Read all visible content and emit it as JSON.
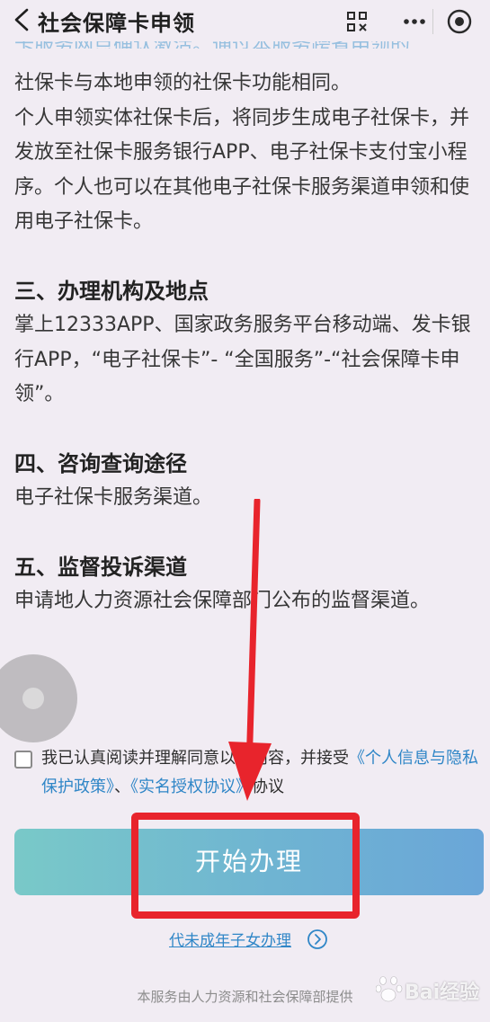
{
  "nav": {
    "title": "社会保障卡申领",
    "back_icon": "chevron-left-icon",
    "capsule_icons": [
      "scan-icon",
      "more-icon",
      "close-circle-icon"
    ]
  },
  "content": {
    "partial_top_line": "卡服务网点确认激活。通过本服务跨省申领的",
    "paragraph_1_line_1": "社保卡与本地申领的社保卡功能相同。",
    "paragraph_2": "个人申领实体社保卡后，将同步生成电子社保卡，并发放至社保卡服务银行APP、电子社保卡支付宝小程序。个人也可以在其他电子社保卡服务渠道申领和使用电子社保卡。",
    "section_3_title": "三、办理机构及地点",
    "section_3_body": "掌上12333APP、国家政务服务平台移动端、发卡银行APP，“电子社保卡”- “全国服务”-“社会保障卡申领”。",
    "section_4_title": "四、咨询查询途径",
    "section_4_body": "电子社保卡服务渠道。",
    "section_5_title": "五、监督投诉渠道",
    "section_5_body": "申请地人力资源社会保障部门公布的监督渠道。"
  },
  "agreement": {
    "text_before": "我已认真阅读并理解同意以上内容，并接受",
    "link_privacy": "《个人信息与隐私保护政策》",
    "separator": "、",
    "link_realname": "《实名授权协议》",
    "text_after": "协议",
    "checked": false
  },
  "start_button": {
    "label": "开始办理"
  },
  "proxy_link": {
    "label": "代未成年子女办理",
    "icon": "chevron-right-circle-icon"
  },
  "footer": {
    "note": "本服务由人力资源和社会保障部提供"
  },
  "watermark": {
    "text": "Bai经验"
  },
  "colors": {
    "background": "#f1ecf3",
    "link": "#2f86c7",
    "button_gradient_start": "#79c9c8",
    "button_gradient_end": "#6aa6d8",
    "annotation_red": "#e8242c"
  }
}
